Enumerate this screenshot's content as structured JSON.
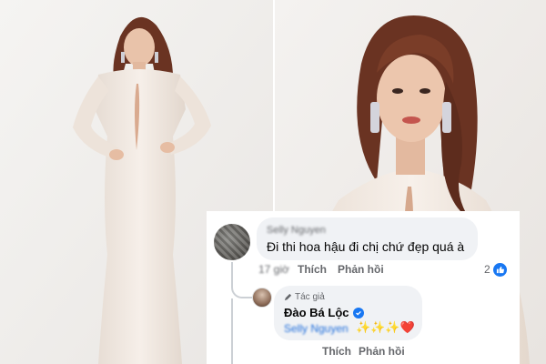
{
  "colors": {
    "bubble_bg": "#f0f2f5",
    "link_blue": "#216fdb",
    "meta_gray": "#65676b",
    "verified_blue": "#1877f2",
    "heart_red": "#e4264a",
    "dress_ivory": "#f3ebe4",
    "hair_brown": "#6a3322"
  },
  "photos": {
    "left": "full-length-portrait-white-gown",
    "right": "close-up-portrait-white-gown"
  },
  "comment": {
    "author": "Selly Nguyen",
    "text": "Đi thi hoa hậu đi chị chứ đẹp quá à",
    "time": "17 giờ",
    "like_label": "Thích",
    "reply_label": "Phản hồi",
    "reaction_count": "2",
    "reaction_icon": "thumbs-up-icon"
  },
  "reply": {
    "badge": "Tác giả",
    "badge_icon": "pen-icon",
    "author": "Đào Bá Lộc",
    "verified_icon": "verified-badge-icon",
    "mention": "Selly Nguyen",
    "emoji": "✨✨✨❤️",
    "like_label": "Thích",
    "reply_label": "Phản hồi"
  }
}
